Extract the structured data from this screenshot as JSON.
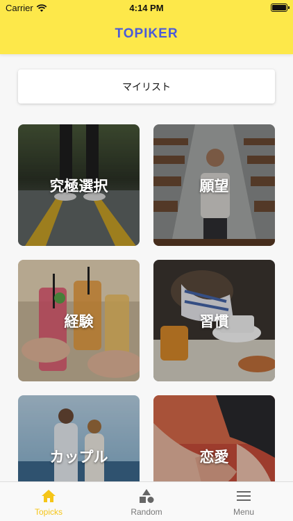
{
  "status_bar": {
    "carrier": "Carrier",
    "time": "4:14 PM"
  },
  "header": {
    "title": "TOPIKER"
  },
  "mylist": {
    "label": "マイリスト"
  },
  "topics": [
    {
      "label": "究極選択"
    },
    {
      "label": "願望"
    },
    {
      "label": "経験"
    },
    {
      "label": "習慣"
    },
    {
      "label": "カップル"
    },
    {
      "label": "恋愛"
    }
  ],
  "tabbar": {
    "items": [
      {
        "label": "Topicks",
        "icon": "home-icon",
        "active": true
      },
      {
        "label": "Random",
        "icon": "shapes-icon",
        "active": false
      },
      {
        "label": "Menu",
        "icon": "hamburger-icon",
        "active": false
      }
    ]
  },
  "colors": {
    "header_bg": "#fde84a",
    "brand": "#4a5bd8",
    "tab_active": "#f5c518"
  }
}
